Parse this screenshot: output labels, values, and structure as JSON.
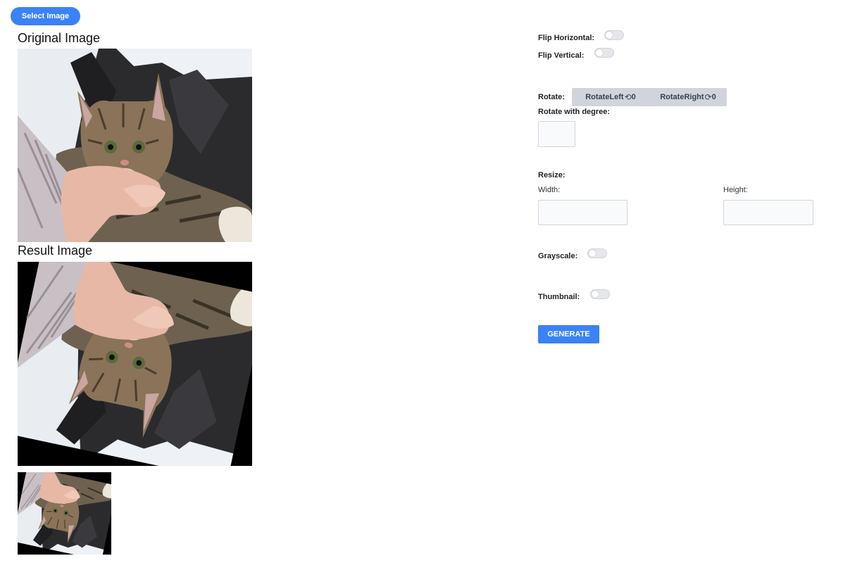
{
  "header": {
    "select_image_label": "Select Image"
  },
  "original": {
    "title": "Original Image"
  },
  "result": {
    "title": "Result Image"
  },
  "controls": {
    "flip_horizontal_label": "Flip Horizontal:",
    "flip_vertical_label": "Flip Vertical:",
    "rotate_label": "Rotate:",
    "rotate_left_label": "RotateLeft",
    "rotate_left_count": "0",
    "rotate_right_label": "RotateRight",
    "rotate_right_count": "0",
    "rotate_degree_label": "Rotate with degree:",
    "rotate_degree_value": "",
    "resize_label": "Resize:",
    "width_label": "Width:",
    "width_value": "",
    "height_label": "Height:",
    "height_value": "",
    "grayscale_label": "Grayscale:",
    "thumbnail_label": "Thumbnail:",
    "generate_label": "GENERATE"
  },
  "toggles": {
    "flip_horizontal": false,
    "flip_vertical": false,
    "grayscale": false,
    "thumbnail": false
  },
  "icons": {
    "rotate_left": "rotate-ccw-icon",
    "rotate_right": "rotate-cw-icon"
  },
  "colors": {
    "accent": "#3b82f6",
    "rotate_group_bg": "#d1d5db"
  }
}
